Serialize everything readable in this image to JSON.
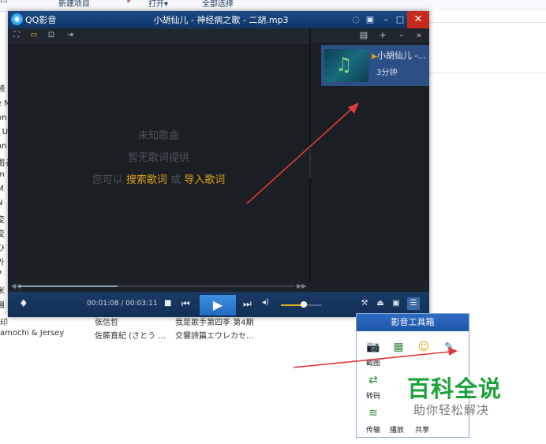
{
  "background": {
    "ribbon": {
      "new_item": "新建项目",
      "open": "打开▾",
      "select_all": "全部选择"
    },
    "left_column": [
      "频",
      "e N",
      "on",
      "f U",
      "an",
      "图る",
      "m",
      "M",
      "N",
      "変",
      "変",
      "ひ",
      "가",
      "P",
      "米",
      "强"
    ],
    "rows": [
      {
        "col1": "印",
        "col2": "张信哲",
        "col3": "我是歌手第四季 第4期"
      },
      {
        "col1": "amochi & Jersey",
        "col2": "佐藤直紀 (さとう ...",
        "col3": "交響詩篇エウレカセ..."
      }
    ]
  },
  "player": {
    "app_name": "QQ影音",
    "title": "小胡仙儿 - 神经病之歌 - 二胡.mp3",
    "lyrics": {
      "unknown_song": "未知歌曲",
      "no_lyrics": "暂无歌词提供",
      "you_can": "您可以",
      "search_lyrics": "搜索歌词",
      "or": "或",
      "import_lyrics": "导入歌词"
    },
    "playlist": [
      {
        "title": "小胡仙儿 -...",
        "duration": "3分钟"
      }
    ],
    "time_display": "00:01:08 / 00:03:11",
    "progress": 0.356,
    "volume": 0.55
  },
  "toolbox": {
    "title": "影音工具箱",
    "tools": [
      {
        "label": "截图",
        "icon": "camera-icon"
      },
      {
        "label": "",
        "icon": "grid-thumbnail-icon"
      },
      {
        "label": "",
        "icon": "smiley-icon"
      },
      {
        "label": "",
        "icon": "edit-document-icon"
      },
      {
        "label": "转码",
        "icon": "convert-icon"
      },
      {
        "label": "传输",
        "icon": "wifi-transfer-icon"
      }
    ],
    "bottom_labels": [
      "播放",
      "共享"
    ]
  },
  "watermark": {
    "brand": "百科全说",
    "slogan": "助你轻松解决"
  }
}
